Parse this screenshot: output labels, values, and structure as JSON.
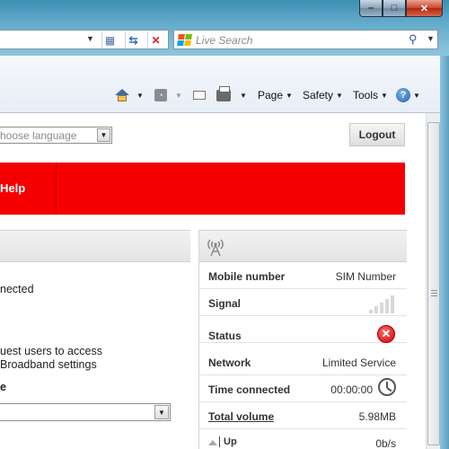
{
  "browser": {
    "window_buttons": {
      "minimize": "–",
      "maximize": "□",
      "close": "✕"
    },
    "address_bar": {
      "dropdown": "▼"
    },
    "search": {
      "placeholder": "Live Search",
      "go_icon": "magnifier-icon"
    },
    "command_bar": {
      "page_label": "Page",
      "safety_label": "Safety",
      "tools_label": "Tools",
      "help_glyph": "?",
      "dropdown_glyph": "▼"
    }
  },
  "page": {
    "language_select": {
      "value": "hoose language"
    },
    "logout_label": "Logout",
    "nav": {
      "help_label": "Help"
    },
    "left_panel": {
      "line1": "nected",
      "line2": "uest users to access",
      "line3": "Broadband settings",
      "heading": "e"
    },
    "status_panel": {
      "icon": "antenna-icon",
      "rows": [
        {
          "label": "Mobile number",
          "value": "SIM Number"
        },
        {
          "label": "Signal",
          "value": ""
        },
        {
          "label": "Status",
          "value": ""
        },
        {
          "label": "Network",
          "value": "Limited Service"
        },
        {
          "label": "Time connected",
          "value": "00:00:00"
        },
        {
          "label": "Total volume",
          "value": "5.98MB"
        },
        {
          "label": "Up",
          "value": "0b/s"
        }
      ],
      "signal_bars": 0,
      "status_glyph": "✕"
    },
    "colors": {
      "brand_red": "#f40000",
      "status_error": "#d10000"
    }
  }
}
